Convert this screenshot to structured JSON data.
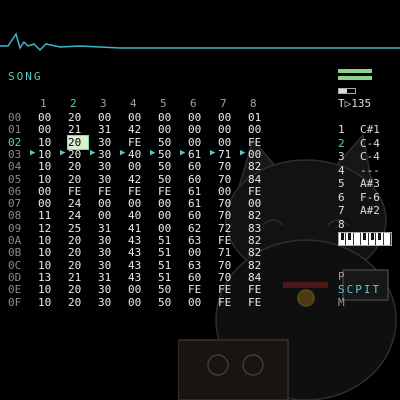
{
  "screen": {
    "title": "SONG"
  },
  "columns": [
    "1",
    "2",
    "3",
    "4",
    "5",
    "6",
    "7",
    "8"
  ],
  "selected_column": 1,
  "rows": [
    {
      "id": "00",
      "cells": [
        "00",
        "20",
        "00",
        "00",
        "00",
        "00",
        "00",
        "01"
      ]
    },
    {
      "id": "01",
      "cells": [
        "00",
        "21",
        "31",
        "42",
        "00",
        "00",
        "00",
        "00"
      ]
    },
    {
      "id": "02",
      "cells": [
        "10",
        "20",
        "30",
        "FE",
        "50",
        "00",
        "00",
        "FE"
      ]
    },
    {
      "id": "03",
      "cells": [
        "10",
        "20",
        "30",
        "40",
        "50",
        "61",
        "71",
        "00"
      ]
    },
    {
      "id": "04",
      "cells": [
        "10",
        "20",
        "30",
        "00",
        "50",
        "60",
        "70",
        "82"
      ]
    },
    {
      "id": "05",
      "cells": [
        "10",
        "20",
        "30",
        "42",
        "50",
        "60",
        "70",
        "84"
      ]
    },
    {
      "id": "06",
      "cells": [
        "00",
        "FE",
        "FE",
        "FE",
        "FE",
        "61",
        "00",
        "FE"
      ]
    },
    {
      "id": "07",
      "cells": [
        "00",
        "24",
        "00",
        "00",
        "00",
        "61",
        "70",
        "00"
      ]
    },
    {
      "id": "08",
      "cells": [
        "11",
        "24",
        "00",
        "40",
        "00",
        "60",
        "70",
        "82"
      ]
    },
    {
      "id": "09",
      "cells": [
        "12",
        "25",
        "31",
        "41",
        "00",
        "62",
        "72",
        "83"
      ]
    },
    {
      "id": "0A",
      "cells": [
        "10",
        "20",
        "30",
        "43",
        "51",
        "63",
        "FE",
        "82"
      ]
    },
    {
      "id": "0B",
      "cells": [
        "10",
        "20",
        "30",
        "43",
        "51",
        "00",
        "71",
        "82"
      ]
    },
    {
      "id": "0C",
      "cells": [
        "10",
        "20",
        "30",
        "43",
        "51",
        "63",
        "70",
        "82"
      ]
    },
    {
      "id": "0D",
      "cells": [
        "13",
        "21",
        "31",
        "43",
        "51",
        "60",
        "70",
        "84"
      ]
    },
    {
      "id": "0E",
      "cells": [
        "10",
        "20",
        "30",
        "00",
        "50",
        "FE",
        "FE",
        "FE"
      ]
    },
    {
      "id": "0F",
      "cells": [
        "10",
        "20",
        "30",
        "00",
        "50",
        "00",
        "FE",
        "FE"
      ]
    }
  ],
  "selected_row": 2,
  "playing_row": 3,
  "cursor": {
    "row": 2,
    "col": 1
  },
  "tempo": "T▷135",
  "channels": [
    {
      "n": "1",
      "note": "C#1"
    },
    {
      "n": "2",
      "note": "C-4"
    },
    {
      "n": "3",
      "note": "C-4"
    },
    {
      "n": "4",
      "note": "---"
    },
    {
      "n": "5",
      "note": "A#3"
    },
    {
      "n": "6",
      "note": "F-6"
    },
    {
      "n": "7",
      "note": "A#2"
    },
    {
      "n": "8",
      "note": ""
    }
  ],
  "selected_channel": 1,
  "modes": [
    "P",
    "SCPIT",
    "M"
  ],
  "colors": {
    "accent": "#5fc8c8",
    "meter": "#8bd38b",
    "cursor": "#d8f0d0"
  },
  "icons": {
    "scope": "oscilloscope-wave",
    "piano": "keyboard-icon",
    "mascot": "lucky-cat-illustration"
  }
}
